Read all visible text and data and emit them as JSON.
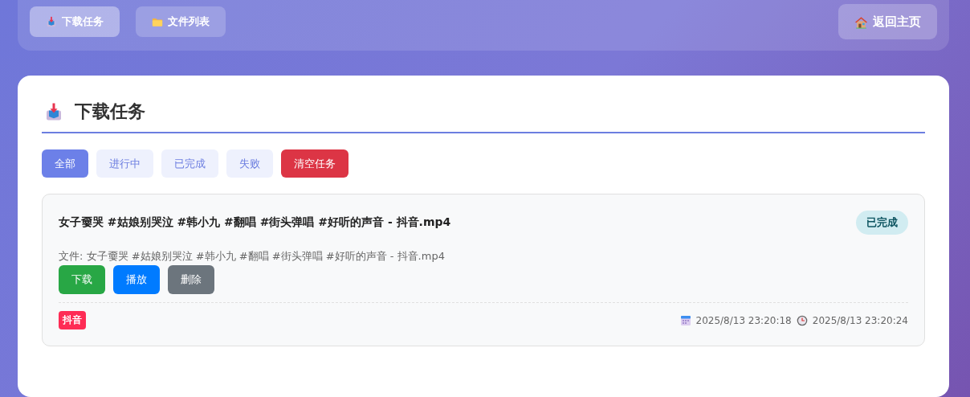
{
  "nav": {
    "tabs": [
      {
        "label": "下载任务",
        "kind": "download",
        "selected": true
      },
      {
        "label": "文件列表",
        "kind": "folder",
        "selected": false
      }
    ],
    "home_button": {
      "label": "返回主页",
      "kind": "house"
    }
  },
  "panel": {
    "title": "下载任务",
    "kind": "download",
    "filters": [
      {
        "label": "全部",
        "kind": "filter",
        "selected": true
      },
      {
        "label": "进行中",
        "kind": "filter",
        "selected": false
      },
      {
        "label": "已完成",
        "kind": "filter",
        "selected": false
      },
      {
        "label": "失败",
        "kind": "filter",
        "selected": false
      },
      {
        "label": "清空任务",
        "kind": "danger"
      }
    ],
    "tasks": [
      {
        "title": "女子嫑哭 #姑娘别哭泣 #韩小九 #翻唱 #街头弹唱 #好听的声音 - 抖音.mp4",
        "status": {
          "label": "已完成",
          "kind": "completed"
        },
        "file": "文件: 女子嫑哭 #姑娘别哭泣 #韩小九 #翻唱 #街头弹唱 #好听的声音 - 抖音.mp4",
        "actions": [
          {
            "label": "下载",
            "kind": "download"
          },
          {
            "label": "播放",
            "kind": "play"
          },
          {
            "label": "删除",
            "kind": "delete"
          }
        ],
        "platform": "抖音",
        "created": "2025/8/13 23:20:18",
        "finished": "2025/8/13 23:20:24"
      }
    ]
  }
}
